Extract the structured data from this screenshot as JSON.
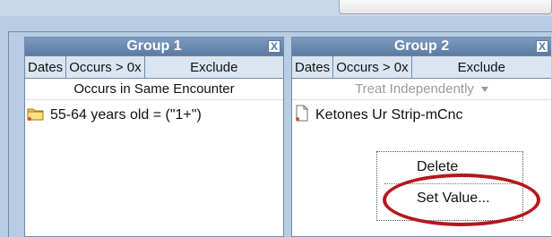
{
  "groups": [
    {
      "title": "Group 1",
      "close_label": "X",
      "tabs": [
        "Dates",
        "Occurs > 0x",
        "Exclude"
      ],
      "timing": "Occurs in Same Encounter",
      "items": [
        "55-64 years old = (\"1+\")"
      ]
    },
    {
      "title": "Group 2",
      "close_label": "X",
      "tabs": [
        "Dates",
        "Occurs > 0x",
        "Exclude"
      ],
      "timing": "Treat Independently",
      "items": [
        "Ketones Ur Strip-mCnc"
      ]
    }
  ],
  "context_menu": {
    "delete": "Delete",
    "set_value": "Set Value..."
  },
  "colors": {
    "header": "#6b89b0",
    "background": "#b8cde4",
    "annotation": "#b3171c"
  },
  "icons": {
    "folder": "folder-icon",
    "document": "document-icon"
  }
}
